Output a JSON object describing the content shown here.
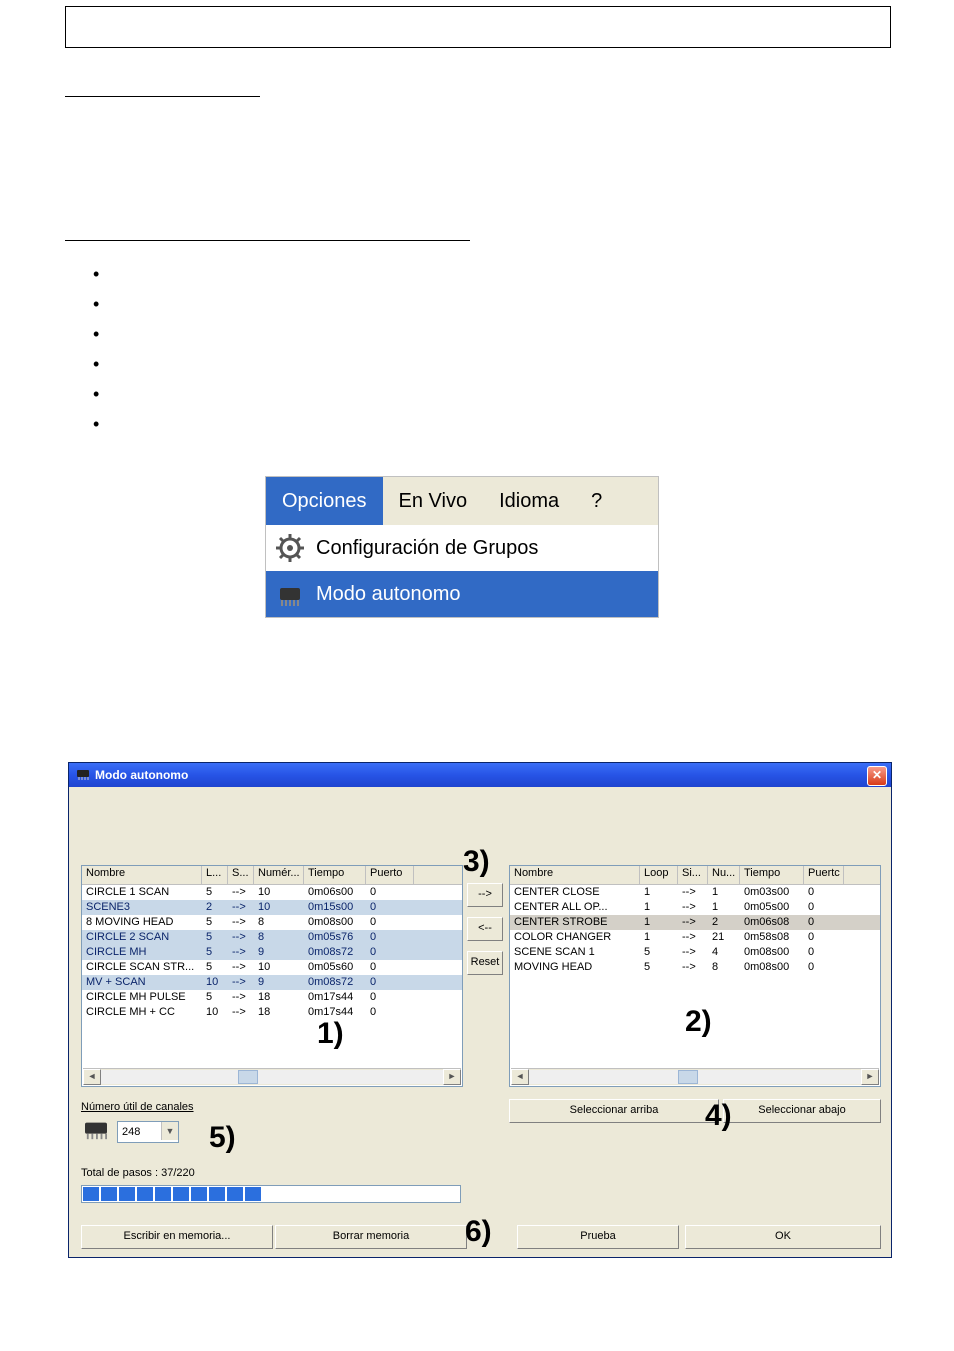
{
  "menu": {
    "bar": {
      "opciones": "Opciones",
      "envivo": "En Vivo",
      "idioma": "Idioma",
      "help": "?"
    },
    "items": {
      "grupos": "Configuración de Grupos",
      "autonomo": "Modo autonomo"
    }
  },
  "dialog": {
    "title": "Modo autonomo",
    "left_headers": [
      "Nombre",
      "L...",
      "S...",
      "Numér...",
      "Tiempo",
      "Puerto"
    ],
    "right_headers": [
      "Nombre",
      "Loop",
      "Si...",
      "Nu...",
      "Tiempo",
      "Puertc"
    ],
    "left_rows": [
      {
        "n": "CIRCLE 1 SCAN",
        "l": "5",
        "s": "-->",
        "nu": "10",
        "t": "0m06s00",
        "p": "0",
        "sel": false
      },
      {
        "n": "SCENE3",
        "l": "2",
        "s": "-->",
        "nu": "10",
        "t": "0m15s00",
        "p": "0",
        "sel": true
      },
      {
        "n": "8 MOVING HEAD",
        "l": "5",
        "s": "-->",
        "nu": "8",
        "t": "0m08s00",
        "p": "0",
        "sel": false
      },
      {
        "n": "CIRCLE 2 SCAN",
        "l": "5",
        "s": "-->",
        "nu": "8",
        "t": "0m05s76",
        "p": "0",
        "sel": true
      },
      {
        "n": "CIRCLE MH",
        "l": "5",
        "s": "-->",
        "nu": "9",
        "t": "0m08s72",
        "p": "0",
        "sel": true
      },
      {
        "n": "CIRCLE SCAN STR...",
        "l": "5",
        "s": "-->",
        "nu": "10",
        "t": "0m05s60",
        "p": "0",
        "sel": false
      },
      {
        "n": "MV + SCAN",
        "l": "10",
        "s": "-->",
        "nu": "9",
        "t": "0m08s72",
        "p": "0",
        "sel": true
      },
      {
        "n": "CIRCLE MH PULSE",
        "l": "5",
        "s": "-->",
        "nu": "18",
        "t": "0m17s44",
        "p": "0",
        "sel": false
      },
      {
        "n": "CIRCLE MH + CC",
        "l": "10",
        "s": "-->",
        "nu": "18",
        "t": "0m17s44",
        "p": "0",
        "sel": false
      }
    ],
    "right_rows": [
      {
        "n": "CENTER CLOSE",
        "l": "1",
        "s": "-->",
        "nu": "1",
        "t": "0m03s00",
        "p": "0",
        "sel": false
      },
      {
        "n": "CENTER ALL OP...",
        "l": "1",
        "s": "-->",
        "nu": "1",
        "t": "0m05s00",
        "p": "0",
        "sel": false
      },
      {
        "n": "CENTER STROBE",
        "l": "1",
        "s": "-->",
        "nu": "2",
        "t": "0m06s08",
        "p": "0",
        "sel": true
      },
      {
        "n": "COLOR CHANGER",
        "l": "1",
        "s": "-->",
        "nu": "21",
        "t": "0m58s08",
        "p": "0",
        "sel": false
      },
      {
        "n": "SCENE SCAN 1",
        "l": "5",
        "s": "-->",
        "nu": "4",
        "t": "0m08s00",
        "p": "0",
        "sel": false
      },
      {
        "n": "MOVING HEAD",
        "l": "5",
        "s": "-->",
        "nu": "8",
        "t": "0m08s00",
        "p": "0",
        "sel": false
      }
    ],
    "midbtns": {
      "add": "-->",
      "remove": "<--",
      "reset": "Reset"
    },
    "sel_up": "Seleccionar arriba",
    "sel_down": "Seleccionar abajo",
    "channels_label": "Número útil de canales",
    "channels_value": "248",
    "steps": "Total de pasos : 37/220",
    "btn_write": "Escribir en memoria...",
    "btn_erase": "Borrar memoria",
    "btn_test": "Prueba",
    "btn_ok": "OK"
  },
  "callouts": {
    "c1": "1)",
    "c2": "2)",
    "c3": "3)",
    "c4": "4)",
    "c5": "5)",
    "c6": "6)"
  }
}
